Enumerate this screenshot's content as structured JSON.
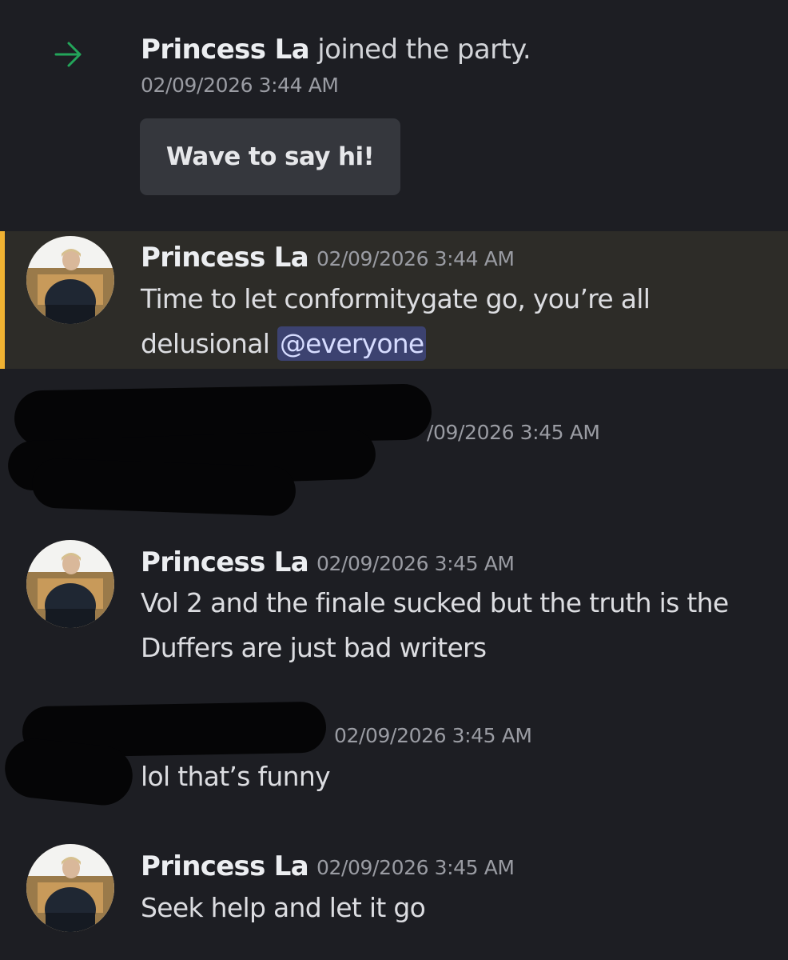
{
  "join_event": {
    "user": "Princess La",
    "text": " joined the party.",
    "timestamp": "02/09/2026 3:44 AM",
    "wave_button_label": "Wave to say hi!"
  },
  "messages": [
    {
      "author": "Princess La",
      "timestamp": "02/09/2026 3:44 AM",
      "line1": "Time to let conformitygate go, you’re all",
      "line2": "delusional ",
      "mention": "@everyone",
      "highlighted": true
    },
    {
      "author": "[redacted]",
      "timestamp_visible": "/09/2026 3:45 AM"
    },
    {
      "author": "Princess La",
      "timestamp": "02/09/2026 3:45 AM",
      "line1": "Vol 2 and the finale sucked but the truth is the",
      "line2": "Duffers are just bad writers"
    },
    {
      "author": "[redacted]",
      "timestamp": "02/09/2026 3:45 AM",
      "line1": "lol that’s funny"
    },
    {
      "author": "Princess La",
      "timestamp": "02/09/2026 3:45 AM",
      "line1": "Seek help and let it go"
    }
  ],
  "colors": {
    "background": "#1d1e23",
    "highlight_row": "#2d2c28",
    "highlight_bar": "#f0b232",
    "join_arrow": "#23a55a",
    "mention_bg": "#3c4270",
    "button_bg": "#35373d"
  },
  "icons": {
    "join": "arrow-right-icon"
  }
}
